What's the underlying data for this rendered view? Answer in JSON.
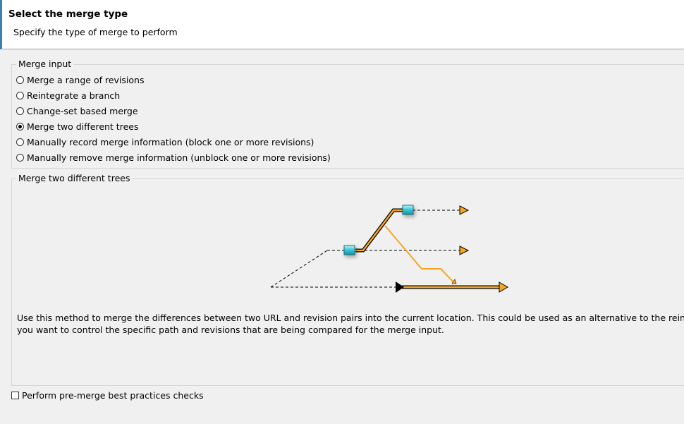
{
  "header": {
    "title": "Select the merge type",
    "subtitle": "Specify the type of merge to perform"
  },
  "merge_input": {
    "legend": "Merge input",
    "options": [
      {
        "label": "Merge a range of revisions",
        "checked": false
      },
      {
        "label": "Reintegrate a branch",
        "checked": false
      },
      {
        "label": "Change-set based merge",
        "checked": false
      },
      {
        "label": "Merge two different trees",
        "checked": true
      },
      {
        "label": "Manually record merge information (block one or more revisions)",
        "checked": false
      },
      {
        "label": "Manually remove merge information (unblock one or more revisions)",
        "checked": false
      }
    ]
  },
  "details": {
    "legend": "Merge two different trees",
    "description_line1": "Use this method to merge the differences between two URL and revision pairs into the current location.  This could be used as an alternative to the reintegrate me",
    "description_line2": "you want to control the specific path and revisions that are being compared for the merge input."
  },
  "premerge_check": {
    "label": "Perform pre-merge best practices checks",
    "checked": false
  },
  "colors": {
    "accent_orange": "#f5a623",
    "node_cyan": "#34c6d6",
    "window_bg": "#f0f0f0"
  }
}
